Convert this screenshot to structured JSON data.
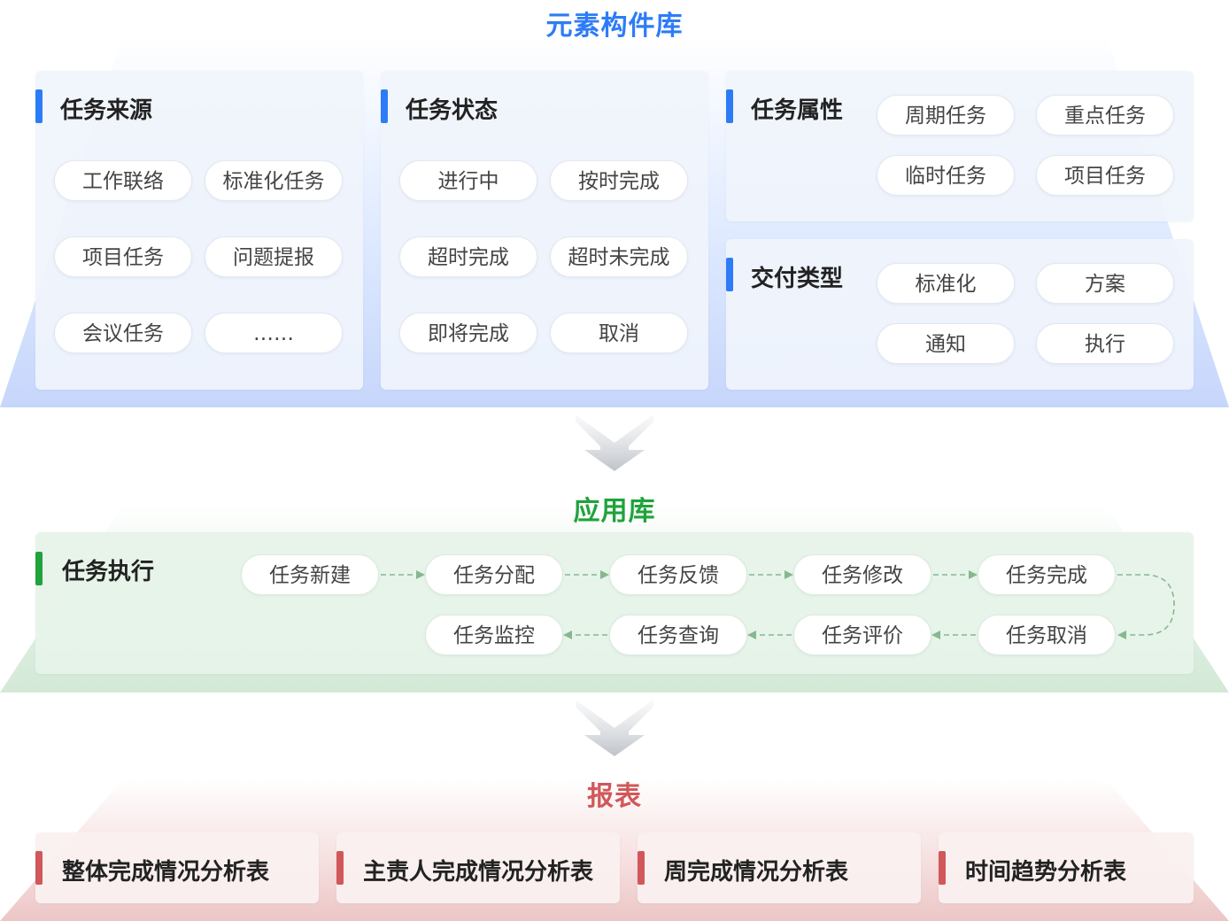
{
  "element_library": {
    "title": "元素构件库",
    "title_color": "#2d7cf6",
    "groups": [
      {
        "title": "任务来源",
        "items": [
          "工作联络",
          "标准化任务",
          "项目任务",
          "问题提报",
          "会议任务",
          "……"
        ]
      },
      {
        "title": "任务状态",
        "items": [
          "进行中",
          "按时完成",
          "超时完成",
          "超时未完成",
          "即将完成",
          "取消"
        ]
      },
      {
        "title": "任务属性",
        "items": [
          "周期任务",
          "重点任务",
          "临时任务",
          "项目任务"
        ]
      },
      {
        "title": "交付类型",
        "items": [
          "标准化",
          "方案",
          "通知",
          "执行"
        ]
      }
    ]
  },
  "application_library": {
    "title": "应用库",
    "title_color": "#1fa33a",
    "group_title": "任务执行",
    "flow_row1": [
      "任务新建",
      "任务分配",
      "任务反馈",
      "任务修改",
      "任务完成"
    ],
    "flow_row2": [
      "任务监控",
      "任务查询",
      "任务评价",
      "任务取消"
    ]
  },
  "reports": {
    "title": "报表",
    "title_color": "#d0585a",
    "items": [
      "整体完成情况分析表",
      "主责人完成情况分析表",
      "周完成情况分析表",
      "时间趋势分析表"
    ]
  },
  "icons": {
    "section_arrow": "down-chevron-arrow-icon",
    "flow_arrow": "dashed-arrow-icon"
  }
}
